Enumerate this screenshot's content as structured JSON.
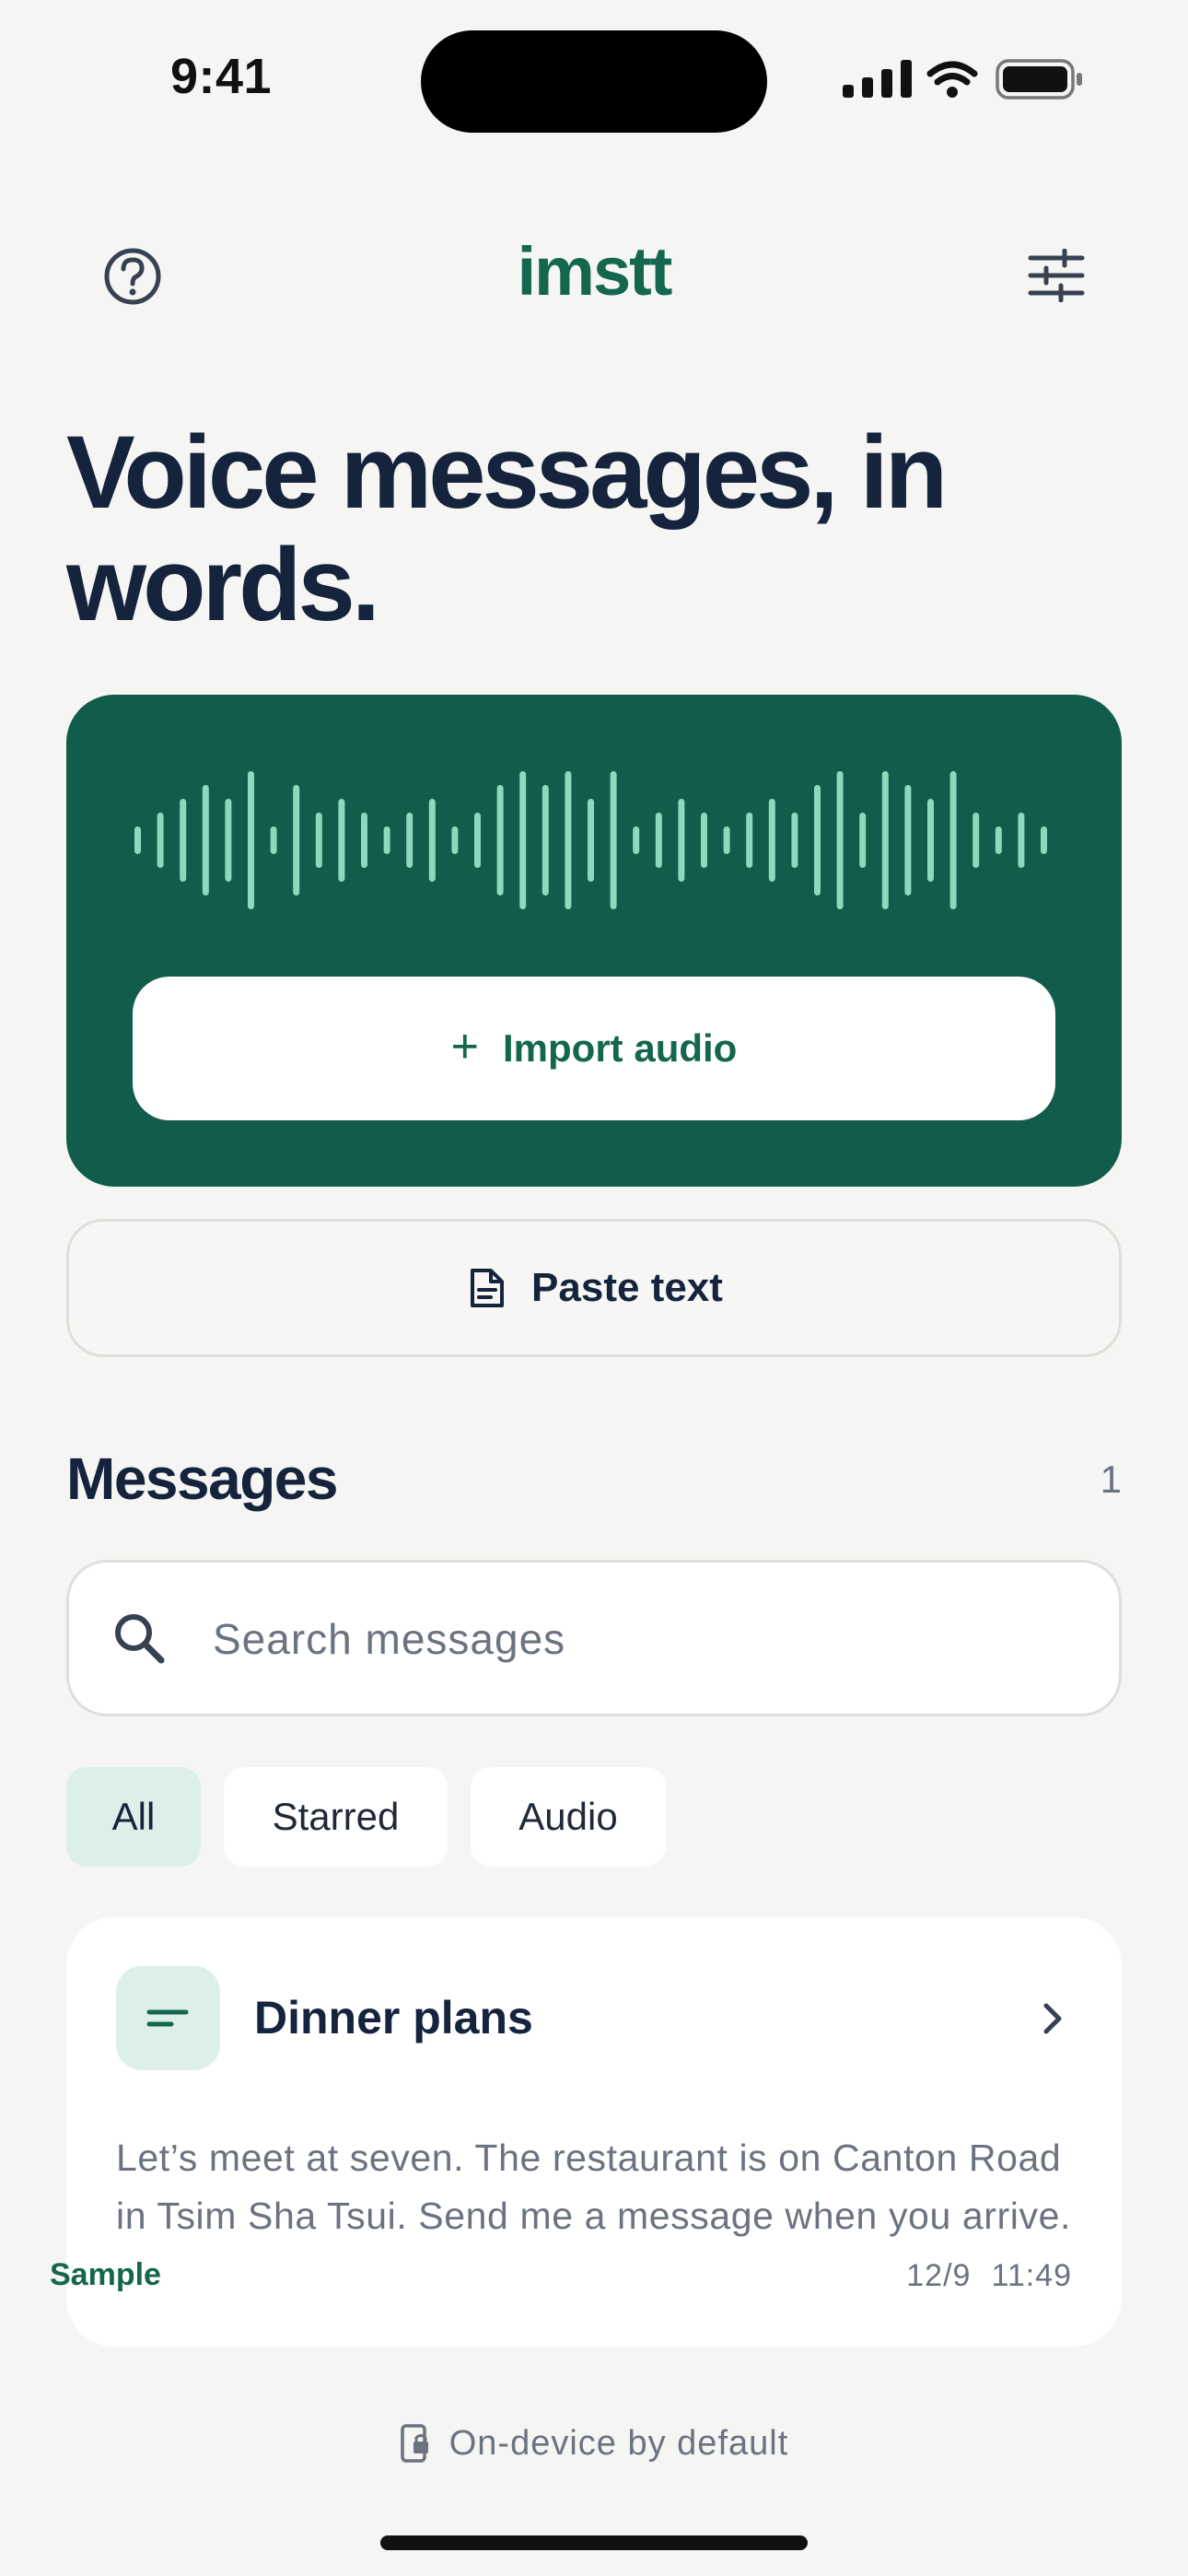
{
  "status_bar": {
    "time": "9:41"
  },
  "header": {
    "brand": "imstt",
    "help_icon": "help-circle-icon",
    "settings_icon": "sliders-icon"
  },
  "hero": {
    "title": "Voice messages, in words."
  },
  "import": {
    "label": "Import audio",
    "plus": "+"
  },
  "paste": {
    "label": "Paste text"
  },
  "messages": {
    "title": "Messages",
    "count": "1",
    "search_placeholder": "Search messages",
    "filters": [
      "All",
      "Starred",
      "Audio"
    ],
    "active_filter": "All",
    "items": [
      {
        "title": "Dinner plans",
        "preview": "Let’s meet at seven. The restaurant is on Canton Road in Tsim Sha Tsui. Send me a message when you arrive.",
        "tag": "Sample",
        "date": "12/9",
        "time": "11:49"
      }
    ]
  },
  "footer": {
    "text": "On-device by default"
  },
  "colors": {
    "brand": "#14664e",
    "card": "#115c4a",
    "wave": "#8fd8bb",
    "chip_active": "#dcefe8"
  }
}
